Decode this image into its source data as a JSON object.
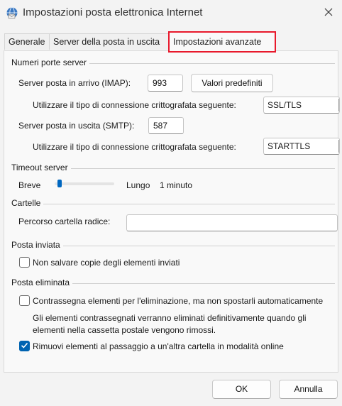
{
  "window": {
    "title": "Impostazioni posta elettronica Internet",
    "icon": "outlook-globe-icon",
    "close_glyph": "✕"
  },
  "tabs": [
    {
      "label": "Generale",
      "active": false
    },
    {
      "label": "Server della posta in uscita",
      "active": false
    },
    {
      "label": "Impostazioni avanzate",
      "active": true
    }
  ],
  "ports": {
    "group_label": "Numeri porte server",
    "incoming_label": "Server posta in arrivo (IMAP):",
    "incoming_value": "993",
    "defaults_button": "Valori predefiniti",
    "incoming_encryption_label": "Utilizzare il tipo di connessione crittografata seguente:",
    "incoming_encryption_value": "SSL/TLS",
    "outgoing_label": "Server posta in uscita (SMTP):",
    "outgoing_value": "587",
    "outgoing_encryption_label": "Utilizzare il tipo di connessione crittografata seguente:",
    "outgoing_encryption_value": "STARTTLS"
  },
  "timeout": {
    "group_label": "Timeout server",
    "short_label": "Breve",
    "long_label": "Lungo",
    "value_label": "1 minuto",
    "slider_fraction": 0.05
  },
  "folders": {
    "group_label": "Cartelle",
    "root_label": "Percorso cartella radice:",
    "root_value": ""
  },
  "sent": {
    "group_label": "Posta inviata",
    "no_copies_label": "Non salvare copie degli elementi inviati",
    "no_copies_checked": false
  },
  "deleted": {
    "group_label": "Posta eliminata",
    "mark_label": "Contrassegna elementi per l'eliminazione, ma non spostarli automaticamente",
    "mark_checked": false,
    "mark_note_line1": "Gli elementi contrassegnati verranno eliminati definitivamente quando gli",
    "mark_note_line2": "elementi nella cassetta postale vengono rimossi.",
    "purge_label": "Rimuovi elementi al passaggio a un'altra cartella in modalità online",
    "purge_checked": true
  },
  "footer": {
    "ok_label": "OK",
    "cancel_label": "Annulla"
  },
  "colors": {
    "accent": "#0063b1",
    "highlight_border": "#e8192c"
  }
}
